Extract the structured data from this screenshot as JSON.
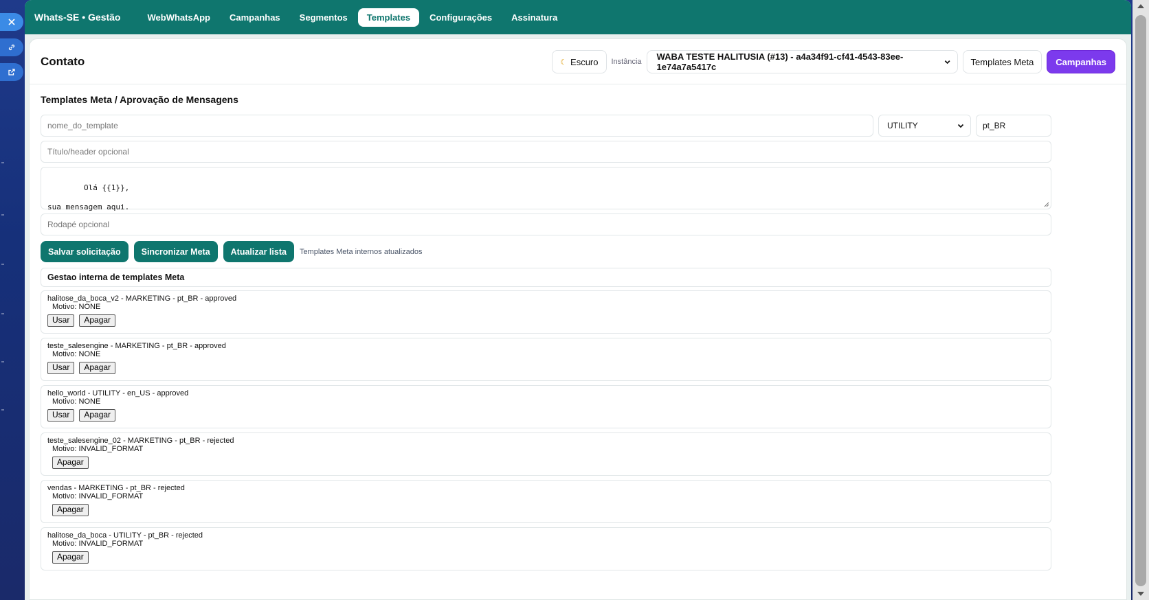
{
  "nav": {
    "brand": "Whats-SE • Gestão",
    "items": [
      {
        "label": "WebWhatsApp",
        "active": false
      },
      {
        "label": "Campanhas",
        "active": false
      },
      {
        "label": "Segmentos",
        "active": false
      },
      {
        "label": "Templates",
        "active": true
      },
      {
        "label": "Configurações",
        "active": false
      },
      {
        "label": "Assinatura",
        "active": false
      }
    ]
  },
  "header": {
    "title": "Contato",
    "theme_label": "Escuro",
    "instance_label": "Instância",
    "instance_value": "WABA TESTE HALITUSIA (#13) - a4a34f91-cf41-4543-83ee-1e74a7a5417c",
    "templates_meta_label": "Templates Meta",
    "campanhas_label": "Campanhas"
  },
  "form": {
    "section_title": "Templates Meta / Aprovação de Mensagens",
    "name_placeholder": "nome_do_template",
    "category_value": "UTILITY",
    "language_value": "pt_BR",
    "header_placeholder": "Título/header opcional",
    "body_value": "Olá {{1}},\n\nsua mensagem aqui.",
    "footer_placeholder": "Rodapé opcional",
    "save_label": "Salvar solicitação",
    "sync_label": "Sincronizar Meta",
    "refresh_label": "Atualizar lista",
    "status_text": "Templates Meta internos atualizados"
  },
  "list": {
    "title": "Gestao interna de templates Meta",
    "use_label": "Usar",
    "delete_label": "Apagar",
    "templates": [
      {
        "summary": "halitose_da_boca_v2 - MARKETING - pt_BR - approved",
        "motivo": "Motivo: NONE",
        "can_use": true
      },
      {
        "summary": "teste_salesengine - MARKETING - pt_BR - approved",
        "motivo": "Motivo: NONE",
        "can_use": true
      },
      {
        "summary": "hello_world - UTILITY - en_US - approved",
        "motivo": "Motivo: NONE",
        "can_use": true
      },
      {
        "summary": "teste_salesengine_02 - MARKETING - pt_BR - rejected",
        "motivo": "Motivo: INVALID_FORMAT",
        "can_use": false
      },
      {
        "summary": "vendas - MARKETING - pt_BR - rejected",
        "motivo": "Motivo: INVALID_FORMAT",
        "can_use": false
      },
      {
        "summary": "halitose_da_boca - UTILITY - pt_BR - rejected",
        "motivo": "Motivo: INVALID_FORMAT",
        "can_use": false
      }
    ]
  },
  "colors": {
    "primary": "#0f766e",
    "accent": "#7c3aed",
    "background": "#1f3a8a"
  }
}
